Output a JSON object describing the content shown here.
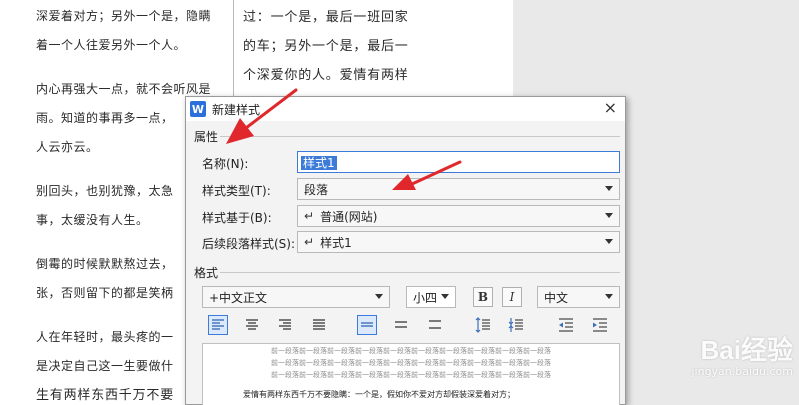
{
  "document": {
    "left_column": [
      "深爱着对方；另外一个是，隐瞒",
      "着一个人往爱另外一个人。",
      "内心再强大一点，就不会听风是",
      "雨。知道的事再多一点，",
      "人云亦云。",
      "别回头，也别犹豫，太急",
      "事，太缓没有人生。",
      "倒霉的时候默默熬过去，",
      "张，否则留下的都是笑柄",
      "人在年轻时，最头疼的一",
      "是决定自己这一生要做什",
      "生有两样东西千万不要"
    ],
    "right_column": [
      "过：一个是，最后一班回家",
      "的车；另外一个是，最后一",
      "个深爱你的人。爱情有两样"
    ]
  },
  "dialog": {
    "app_icon": "W",
    "title": "新建样式",
    "close_label": "×",
    "properties_section": "属性",
    "name_label": "名称(N):",
    "name_value": "样式1",
    "style_type_label": "样式类型(T):",
    "style_type_value": "段落",
    "based_on_label": "样式基于(B):",
    "based_on_value": "普通(网站)",
    "following_label": "后续段落样式(S):",
    "following_value": "样式1",
    "format_section": "格式",
    "font_value": "+中文正文",
    "size_value": "小四",
    "bold_label": "B",
    "italic_label": "I",
    "lang_value": "中文",
    "preview_prev_line1": "前一段落前一段落前一段落前一段落前一段落前一段落前一段落前一段落前一段落前一段落",
    "preview_prev_line2": "前一段落前一段落前一段落前一段落前一段落前一段落前一段落前一段落前一段落前一段落",
    "preview_prev_line3": "前一段落前一段落前一段落前一段落前一段落前一段落前一段落前一段落前一段落前一段落",
    "preview_sample": "爱情有两样东西千万不要隐瞒：一个是，假如你不爱对方却假装深爱着对方；"
  },
  "watermark": {
    "logo": "Bai经验",
    "url": "jingyan.baidu.com"
  },
  "colors": {
    "accent": "#3d7bd9",
    "arrow": "#e0282c"
  },
  "icons": [
    "wps-writer-icon",
    "close-icon",
    "align-left-icon",
    "align-center-icon",
    "align-right-icon",
    "justify-icon",
    "line-spacing-single-icon",
    "line-spacing-1-5-icon",
    "line-spacing-double-icon",
    "paragraph-spacing-increase-icon",
    "paragraph-spacing-decrease-icon",
    "indent-decrease-icon",
    "indent-increase-icon"
  ]
}
